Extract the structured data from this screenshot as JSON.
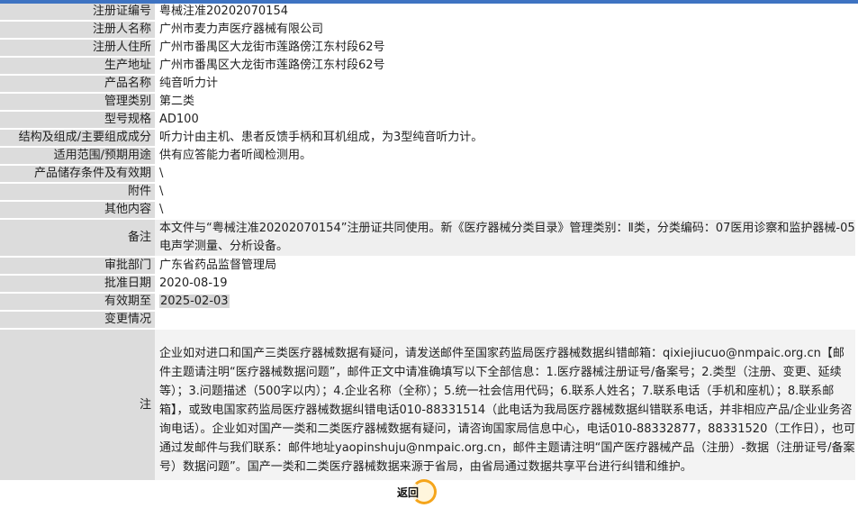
{
  "rows": [
    {
      "label": "注册证编号",
      "value": "粤械注准20202070154"
    },
    {
      "label": "注册人名称",
      "value": "广州市麦力声医疗器械有限公司"
    },
    {
      "label": "注册人住所",
      "value": "广州市番禺区大龙街市莲路傍江东村段62号"
    },
    {
      "label": "生产地址",
      "value": "广州市番禺区大龙街市莲路傍江东村段62号"
    },
    {
      "label": "产品名称",
      "value": "纯音听力计"
    },
    {
      "label": "管理类别",
      "value": "第二类"
    },
    {
      "label": "型号规格",
      "value": "AD100"
    },
    {
      "label": "结构及组成/主要组成成分",
      "value": "听力计由主机、患者反馈手柄和耳机组成，为3型纯音听力计。"
    },
    {
      "label": "适用范围/预期用途",
      "value": "供有应答能力者听阈检测用。"
    },
    {
      "label": "产品储存条件及有效期",
      "value": "\\"
    },
    {
      "label": "附件",
      "value": "\\"
    },
    {
      "label": "其他内容",
      "value": "\\"
    },
    {
      "label": "备注",
      "value": "本文件与“粤械注准20202070154”注册证共同使用。新《医疗器械分类目录》管理类别：Ⅱ类，分类编码：07医用诊察和监护器械-05电声学测量、分析设备。"
    },
    {
      "label": "审批部门",
      "value": "广东省药品监督管理局"
    },
    {
      "label": "批准日期",
      "value": "2020-08-19"
    },
    {
      "label": "有效期至",
      "value": "2025-02-03"
    },
    {
      "label": "变更情况",
      "value": ""
    }
  ],
  "note": {
    "label": "注",
    "text": "企业如对进口和国产三类医疗器械数据有疑问，请发送邮件至国家药监局医疗器械数据纠错邮箱：qixiejiucuo@nmpaic.org.cn【邮件主题请注明“医疗器械数据问题”，邮件正文中请准确填写以下全部信息：1.医疗器械注册证号/备案号；2.类型（注册、变更、延续等）；3.问题描述（500字以内）；4.企业名称（全称）；5.统一社会信用代码；6.联系人姓名；7.联系电话（手机和座机）；8.联系邮箱】，或致电国家药监局医疗器械数据纠错电话010-88331514（此电话为我局医疗器械数据纠错联系电话，并非相应产品/企业业务咨询电话）。企业如对国产一类和二类医疗器械数据有疑问，请咨询国家局信息中心，电话010-88332877，88331520（工作日），也可通过发邮件与我们联系：邮件地址yaopinshuju@nmpaic.org.cn，邮件主题请注明“国产医疗器械产品（注册）-数据（注册证号/备案号）数据问题”。国产一类和二类医疗器械数据来源于省局，由省局通过数据共享平台进行纠错和维护。"
  },
  "back_button": {
    "label": "返回",
    "icon": "back-ring-icon",
    "ring_color": "#f5a51b"
  },
  "colors": {
    "label_bg": "#dcdcdc",
    "top_bar": "#3e73c2"
  }
}
